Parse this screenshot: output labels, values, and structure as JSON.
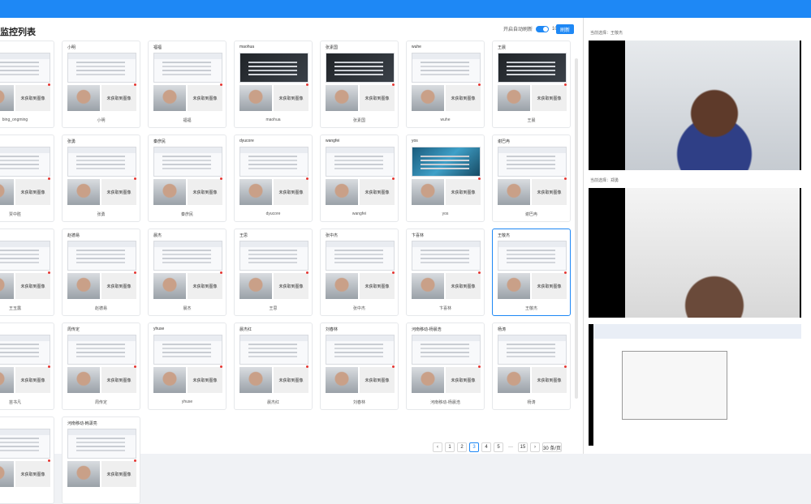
{
  "page": {
    "title": "监控列表",
    "auto_refresh": {
      "label": "开启自动刷新",
      "enabled": true,
      "seconds": "10"
    },
    "refresh_label": "刷新"
  },
  "cards": [
    {
      "name": "nging",
      "sub": "bing_ongming",
      "shot": "light",
      "sel": false
    },
    {
      "name": "小明",
      "sub": "小明",
      "shot": "light",
      "sel": false
    },
    {
      "name": "福福",
      "sub": "福福",
      "shot": "light",
      "sel": false
    },
    {
      "name": "maohua",
      "sub": "maohua",
      "shot": "dark",
      "sel": false
    },
    {
      "name": "张素国",
      "sub": "张素国",
      "shot": "dark",
      "sel": false
    },
    {
      "name": "wuhe",
      "sub": "wuhe",
      "shot": "light",
      "sel": false
    },
    {
      "name": "王晨",
      "sub": "王晨",
      "shot": "dark",
      "sel": false
    },
    {
      "name": "",
      "sub": "贾中胜",
      "shot": "light",
      "sel": false
    },
    {
      "name": "张勇",
      "sub": "张勇",
      "shot": "light",
      "sel": false
    },
    {
      "name": "秦彦民",
      "sub": "秦彦民",
      "shot": "light",
      "sel": false
    },
    {
      "name": "dyucore",
      "sub": "dyucore",
      "shot": "light",
      "sel": false
    },
    {
      "name": "wangfei",
      "sub": "wangfei",
      "shot": "light",
      "sel": false
    },
    {
      "name": "yos",
      "sub": "yos",
      "shot": "sea",
      "sel": false
    },
    {
      "name": "谢巴冉",
      "sub": "谢巴冉",
      "shot": "light",
      "sel": false
    },
    {
      "name": "",
      "sub": "王玉露",
      "shot": "light",
      "sel": false
    },
    {
      "name": "赵德易",
      "sub": "赵德易",
      "shot": "light",
      "sel": false
    },
    {
      "name": "晨杰",
      "sub": "晨杰",
      "shot": "light",
      "sel": false
    },
    {
      "name": "王思",
      "sub": "王思",
      "shot": "light",
      "sel": false
    },
    {
      "name": "张中杰",
      "sub": "张中杰",
      "shot": "light",
      "sel": false
    },
    {
      "name": "卞喜林",
      "sub": "卞喜林",
      "shot": "light",
      "sel": false
    },
    {
      "name": "王敬杰",
      "sub": "王敬杰",
      "shot": "light",
      "sel": true
    },
    {
      "name": "",
      "sub": "苗书凡",
      "shot": "light",
      "sel": false
    },
    {
      "name": "周传定",
      "sub": "周传定",
      "shot": "light",
      "sel": false
    },
    {
      "name": "yhuse",
      "sub": "yhuse",
      "shot": "light",
      "sel": false
    },
    {
      "name": "晨杰红",
      "sub": "晨杰红",
      "shot": "light",
      "sel": false
    },
    {
      "name": "刘春林",
      "sub": "刘春林",
      "shot": "light",
      "sel": false
    },
    {
      "name": "河南移动-杨晨浩",
      "sub": "河南移动-杨晨浩",
      "shot": "light",
      "sel": false
    },
    {
      "name": "杨涛",
      "sub": "杨涛",
      "shot": "light",
      "sel": false
    },
    {
      "name": "",
      "sub": "",
      "shot": "light",
      "sel": false
    },
    {
      "name": "河南移动-韩潇亮",
      "sub": "",
      "shot": "light",
      "sel": false
    }
  ],
  "no_image": "未获取到图像",
  "pager": {
    "prev": "‹",
    "pages": [
      "1",
      "2",
      "3",
      "4",
      "5",
      "···",
      "15"
    ],
    "active": "3",
    "next": "›",
    "size": "30 条/页"
  },
  "right": {
    "label1": "当前选择：王敬杰",
    "label2": "当前选择：郑勇"
  }
}
